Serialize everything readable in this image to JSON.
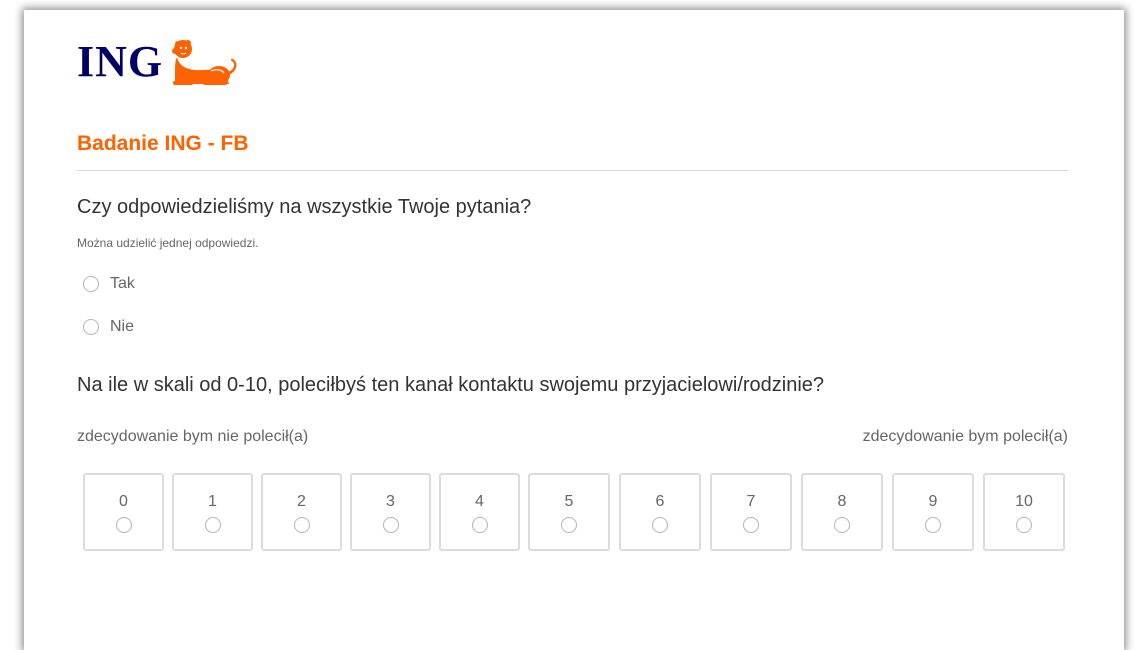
{
  "brand": {
    "logo_text": "ING",
    "accent_color": "#ff6200",
    "logo_color": "#000066",
    "logo_icon": "lion-icon"
  },
  "survey": {
    "title": "Badanie ING - FB"
  },
  "question1": {
    "text": "Czy odpowiedzieliśmy na wszystkie Twoje pytania?",
    "hint": "Można udzielić jednej odpowiedzi.",
    "options": [
      {
        "label": "Tak",
        "selected": false
      },
      {
        "label": "Nie",
        "selected": false
      }
    ]
  },
  "question2": {
    "text": "Na ile w skali od 0-10, poleciłbyś ten kanał kontaktu swojemu przyjacielowi/rodzinie?",
    "scale_min_label": "zdecydowanie bym nie polecił(a)",
    "scale_max_label": "zdecydowanie bym polecił(a)",
    "scale": [
      "0",
      "1",
      "2",
      "3",
      "4",
      "5",
      "6",
      "7",
      "8",
      "9",
      "10"
    ]
  }
}
